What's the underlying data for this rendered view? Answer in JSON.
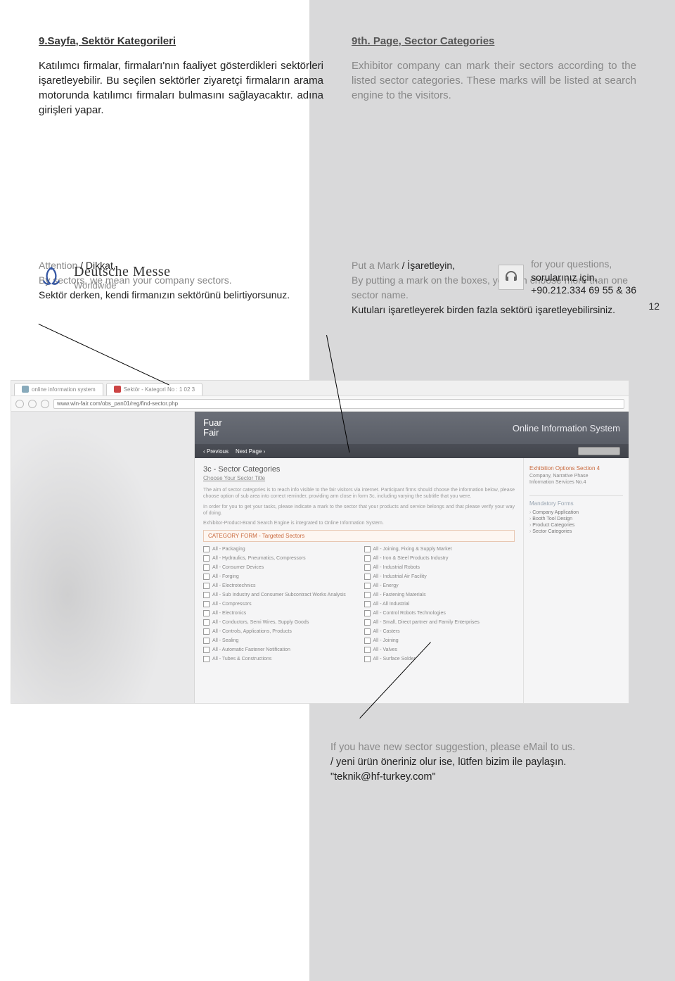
{
  "left": {
    "heading": "9.Sayfa, Sektör Kategorileri",
    "p": "Katılımcı firmalar, firmaları'nın faaliyet gösterdikleri sektörleri işaretleyebilir. Bu seçilen sektörler ziyaretçi firmaların arama motorunda katılımcı firmaları bulmasını sağlayacaktır. adına girişleri yapar."
  },
  "right": {
    "heading": "9th. Page, Sector Categories",
    "p": "Exhibitor company can mark their sectors according to the listed sector categories. These marks will be listed at search engine to the visitors."
  },
  "midLeft": {
    "l1a": "Attention",
    "l1b": " / Dikkat,",
    "l2": "By sectors, we mean your company sectors.",
    "l3": "Sektör derken, kendi firmanızın sektörünü belirtiyorsunuz."
  },
  "midRight": {
    "l1a": "Put a Mark",
    "l1b": " / İşaretleyin,",
    "l2": "By putting a mark on the boxes, you can choose more than one sector name.",
    "l3": "Kutuları işaretleyerek birden fazla sektörü işaretleyebilirsiniz."
  },
  "screenshot": {
    "tab1": "online information system",
    "tab2": "Sektör - Kategori No : 1 02 3",
    "url": "www.win-fair.com/obs_pan01/reg/find-sector.php",
    "brand1": "Fuar",
    "brand2": "Fair",
    "systitle": "Online Information System",
    "navPrev": "‹ Previous",
    "navNext": "Next Page ›",
    "h4": "3c - Sector Categories",
    "sub": "Choose Your Sector Title",
    "desc1": "The aim of sector categories is to reach info visible to the fair visitors via internet. Participant firms should choose the information below, please choose option of sub area into correct reminder, providing arm close in form 3c, including varying the subtitle that you were.",
    "desc2": "In order for you to get your tasks, please indicate a mark to the sector that your products and service belongs and that please verify your way of doing.",
    "engine": "Exhibitor-Product-Brand Search Engine is integrated to Online Information System.",
    "redrow": "CATEGORY FORM - Targeted Sectors",
    "checks": [
      "All - Packaging",
      "All - Joining, Fixing & Supply Market",
      "All - Hydraulics, Pneumatics, Compressors",
      "All - Iron & Steel Products Industry",
      "All - Consumer Devices",
      "All - Industrial Robots",
      "All - Forging",
      "All - Industrial Air Facility",
      "All - Electrotechnics",
      "All - Energy",
      "All - Sub Industry and Consumer Subcontract Works Analysis",
      "All - Fastening Materials",
      "All - Compressors",
      "All - All Industrial",
      "All - Electronics",
      "All - Control Robots Technologies",
      "All - Conductors, Semi Wires, Supply Goods",
      "All - Small, Direct partner and Family Enterprises",
      "All - Controls, Applications, Products",
      "All - Casters",
      "All - Sealing",
      "All - Joining",
      "All - Automatic Fastener Notification",
      "All - Valves",
      "All - Tubes & Constructions",
      "All - Surface Solder"
    ],
    "side": {
      "title": "Exhibition Options Section 4",
      "l1": "Company, Narrative Phase",
      "l2": "Information Services No.4",
      "h2": "Mandatory Forms",
      "items": [
        "Company Application",
        "Booth Tool Design",
        "Product Categories",
        "Sector Categories"
      ]
    }
  },
  "suggest": {
    "l1": "If you have new sector suggestion, please eMail to us.",
    "l2": " / yeni ürün öneriniz olur ise, lütfen bizim ile paylaşın.",
    "l3": "\"teknik@hf-turkey.com\""
  },
  "footer": {
    "brand1": "Deutsche Messe",
    "brand2": "Worldwide",
    "c1": "for your questions,",
    "c2": "sorularınız için,",
    "c3": "+90.212.334 69 55 & 36"
  },
  "pagenum": "12"
}
